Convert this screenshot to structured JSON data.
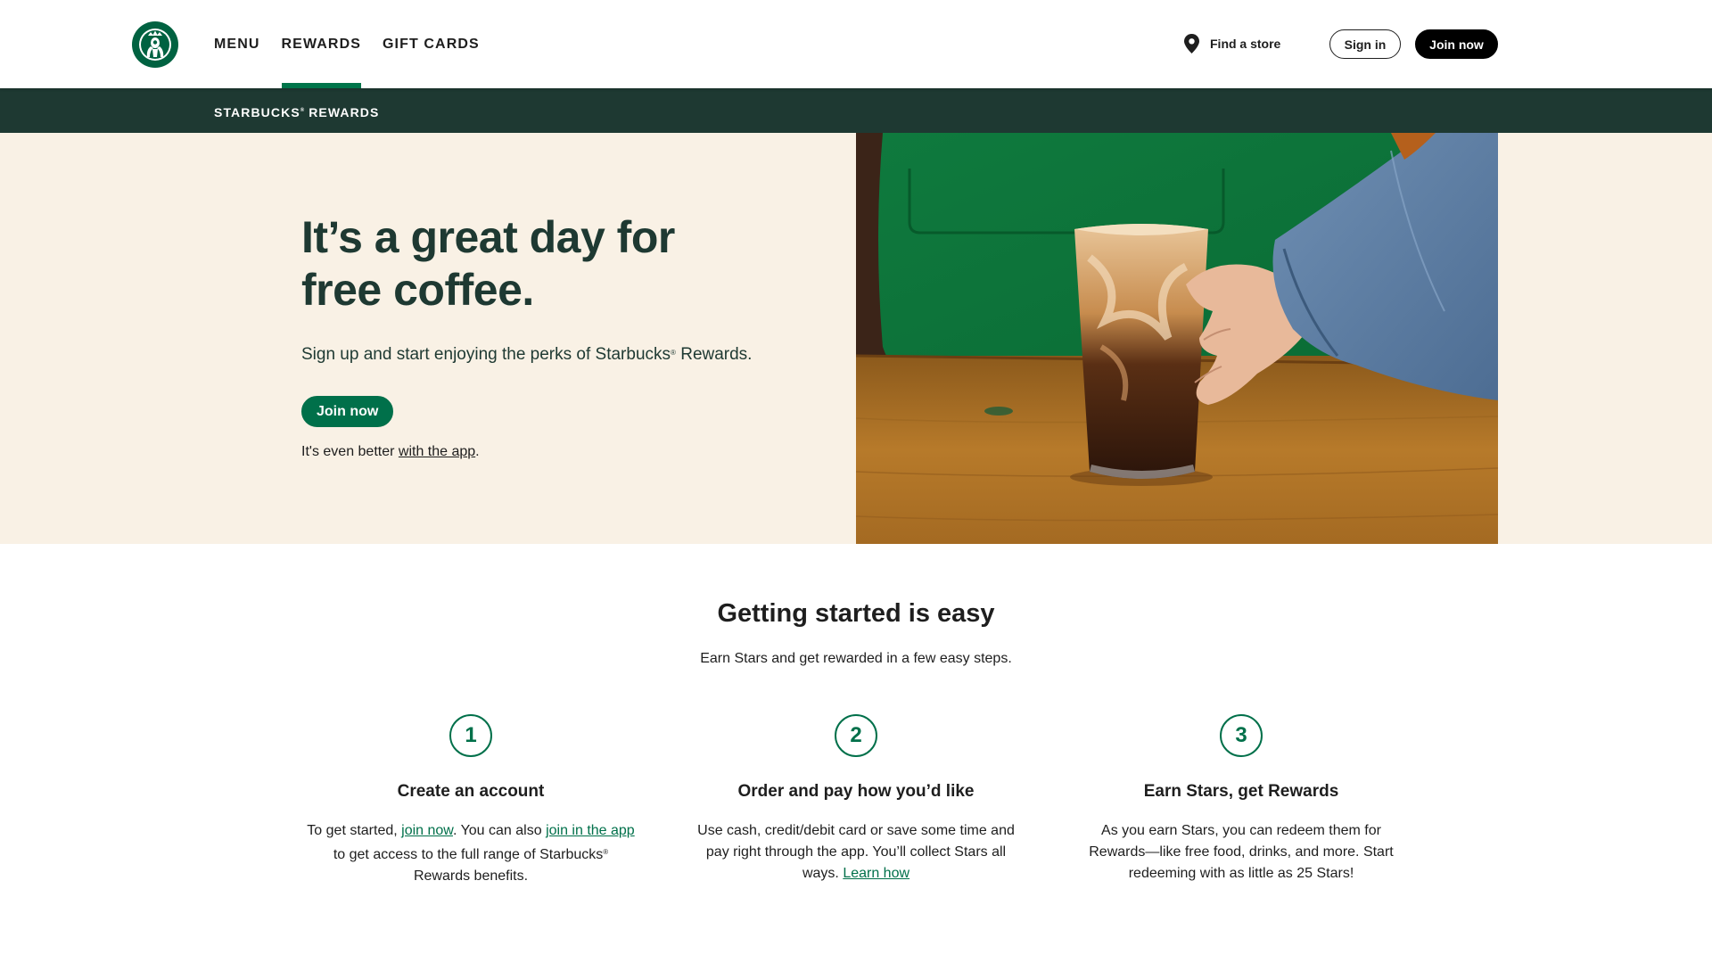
{
  "header": {
    "nav": [
      {
        "label": "MENU",
        "active": false
      },
      {
        "label": "REWARDS",
        "active": true
      },
      {
        "label": "GIFT CARDS",
        "active": false
      }
    ],
    "find_store": "Find a store",
    "sign_in": "Sign in",
    "join_now": "Join now"
  },
  "subbar": {
    "title": "STARBUCKS",
    "reg": "®",
    "title_rest": "REWARDS"
  },
  "hero": {
    "title_line1": "It’s a great day for",
    "title_line2": "free coffee.",
    "subtitle_pre": "Sign up and start enjoying the perks of Starbucks",
    "subtitle_reg": "®",
    "subtitle_post": " Rewards.",
    "join_button": "Join now",
    "note_pre": "It's even better ",
    "note_link": "with the app",
    "note_post": "."
  },
  "getting_started": {
    "title": "Getting started is easy",
    "subtitle": "Earn Stars and get rewarded in a few easy steps.",
    "steps": [
      {
        "number": "1",
        "title": "Create an account",
        "body_pre": "To get started, ",
        "link1": "join now",
        "body_mid": ". You can also ",
        "link2": "join in the app",
        "body_post": " to get access to the full range of Starbucks",
        "reg": "®",
        "body_end": " Rewards benefits."
      },
      {
        "number": "2",
        "title": "Order and pay how you’d like",
        "body_pre": "Use cash, credit/debit card or save some time and pay right through the app. You’ll collect Stars all ways. ",
        "link": "Learn how"
      },
      {
        "number": "3",
        "title": "Earn Stars, get Rewards",
        "body": "As you earn Stars, you can redeem them for Rewards—like free food, drinks, and more. Start redeeming with as little as 25 Stars!"
      }
    ]
  },
  "colors": {
    "brand_green": "#00704a",
    "house_green": "#1e3932",
    "cream": "#f9f1e5",
    "active_underline": "#00754a"
  },
  "icons": [
    "starbucks-siren-logo-icon",
    "location-pin-icon"
  ]
}
